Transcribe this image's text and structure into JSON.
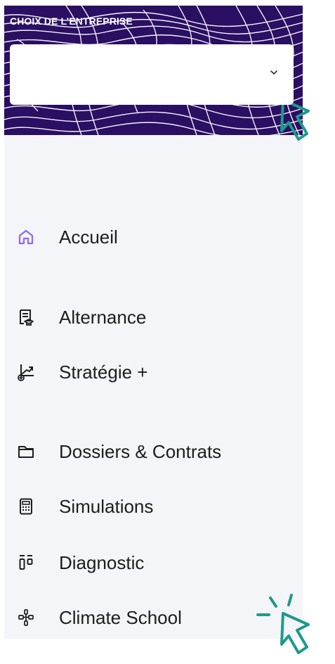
{
  "header": {
    "title": "CHOIX DE L’ENTREPRISE",
    "selected_company": ""
  },
  "menu": {
    "items": [
      {
        "label": "Accueil",
        "icon": "home-icon",
        "state": "active"
      },
      {
        "label": "Alternance",
        "icon": "alternance-icon",
        "state": "default"
      },
      {
        "label": "Stratégie +",
        "icon": "strategy-icon",
        "state": "default"
      },
      {
        "label": "Dossiers & Contrats",
        "icon": "folder-icon",
        "state": "default"
      },
      {
        "label": "Simulations",
        "icon": "calculator-icon",
        "state": "default"
      },
      {
        "label": "Diagnostic",
        "icon": "diagnostic-icon",
        "state": "default"
      },
      {
        "label": "Climate School",
        "icon": "climate-school-icon",
        "state": "default"
      }
    ]
  },
  "colors": {
    "header_bg": "#2a0f63",
    "header_line": "#ffffff",
    "sidebar_bg": "#f4f5f8",
    "text": "#1d1d1f",
    "active_icon": "#8d67f6",
    "cursor": "#1e9a8b"
  }
}
